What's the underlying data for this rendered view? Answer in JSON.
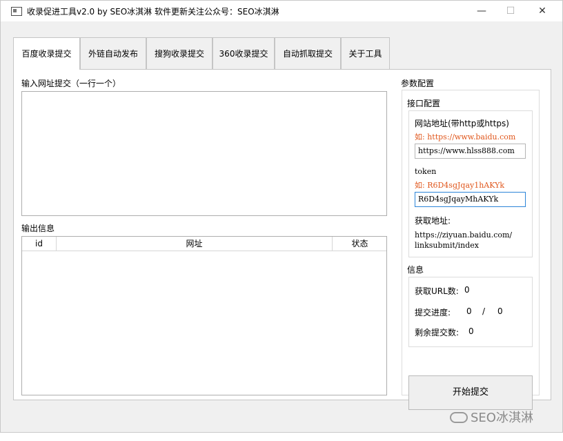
{
  "window": {
    "title": "收录促进工具v2.0 by SEO冰淇淋   软件更新关注公众号：SEO冰淇淋",
    "minimize_glyph": "—",
    "maximize_glyph": "☐",
    "close_glyph": "✕"
  },
  "tabs": [
    {
      "label": "百度收录提交",
      "active": true
    },
    {
      "label": "外链自动发布"
    },
    {
      "label": "搜狗收录提交"
    },
    {
      "label": "360收录提交"
    },
    {
      "label": "自动抓取提交"
    },
    {
      "label": "关于工具"
    }
  ],
  "main": {
    "input_label": "输入网址提交（一行一个）",
    "input_value": "",
    "output_label": "输出信息",
    "table_columns": [
      "id",
      "网址",
      "状态"
    ],
    "table_rows": []
  },
  "params": {
    "section_title": "参数配置",
    "api_group_title": "接口配置",
    "site_label": "网站地址(带http或https)",
    "site_hint": "如: https://www.baidu.com",
    "site_value": "https://www.hlss888.com",
    "token_label": "token",
    "token_hint": "如: R6D4sgJqay1hAKYk",
    "token_value": "R6D4sgJqayMhAKYk",
    "fetch_label": "获取地址:",
    "fetch_url_line1": "https://ziyuan.baidu.com/",
    "fetch_url_line2": "linksubmit/index",
    "info_group_title": "信息",
    "url_count_label": "获取URL数:",
    "url_count_value": "0",
    "progress_label": "提交进度:",
    "progress_done": "0",
    "progress_sep": "/",
    "progress_total": "0",
    "remaining_label": "剩余提交数:",
    "remaining_value": "0",
    "start_button": "开始提交"
  },
  "watermark": "SEO冰淇淋",
  "colors": {
    "hint": "#e0561b",
    "focus_border": "#2b84d8",
    "window_bg": "#f0f0f0"
  }
}
